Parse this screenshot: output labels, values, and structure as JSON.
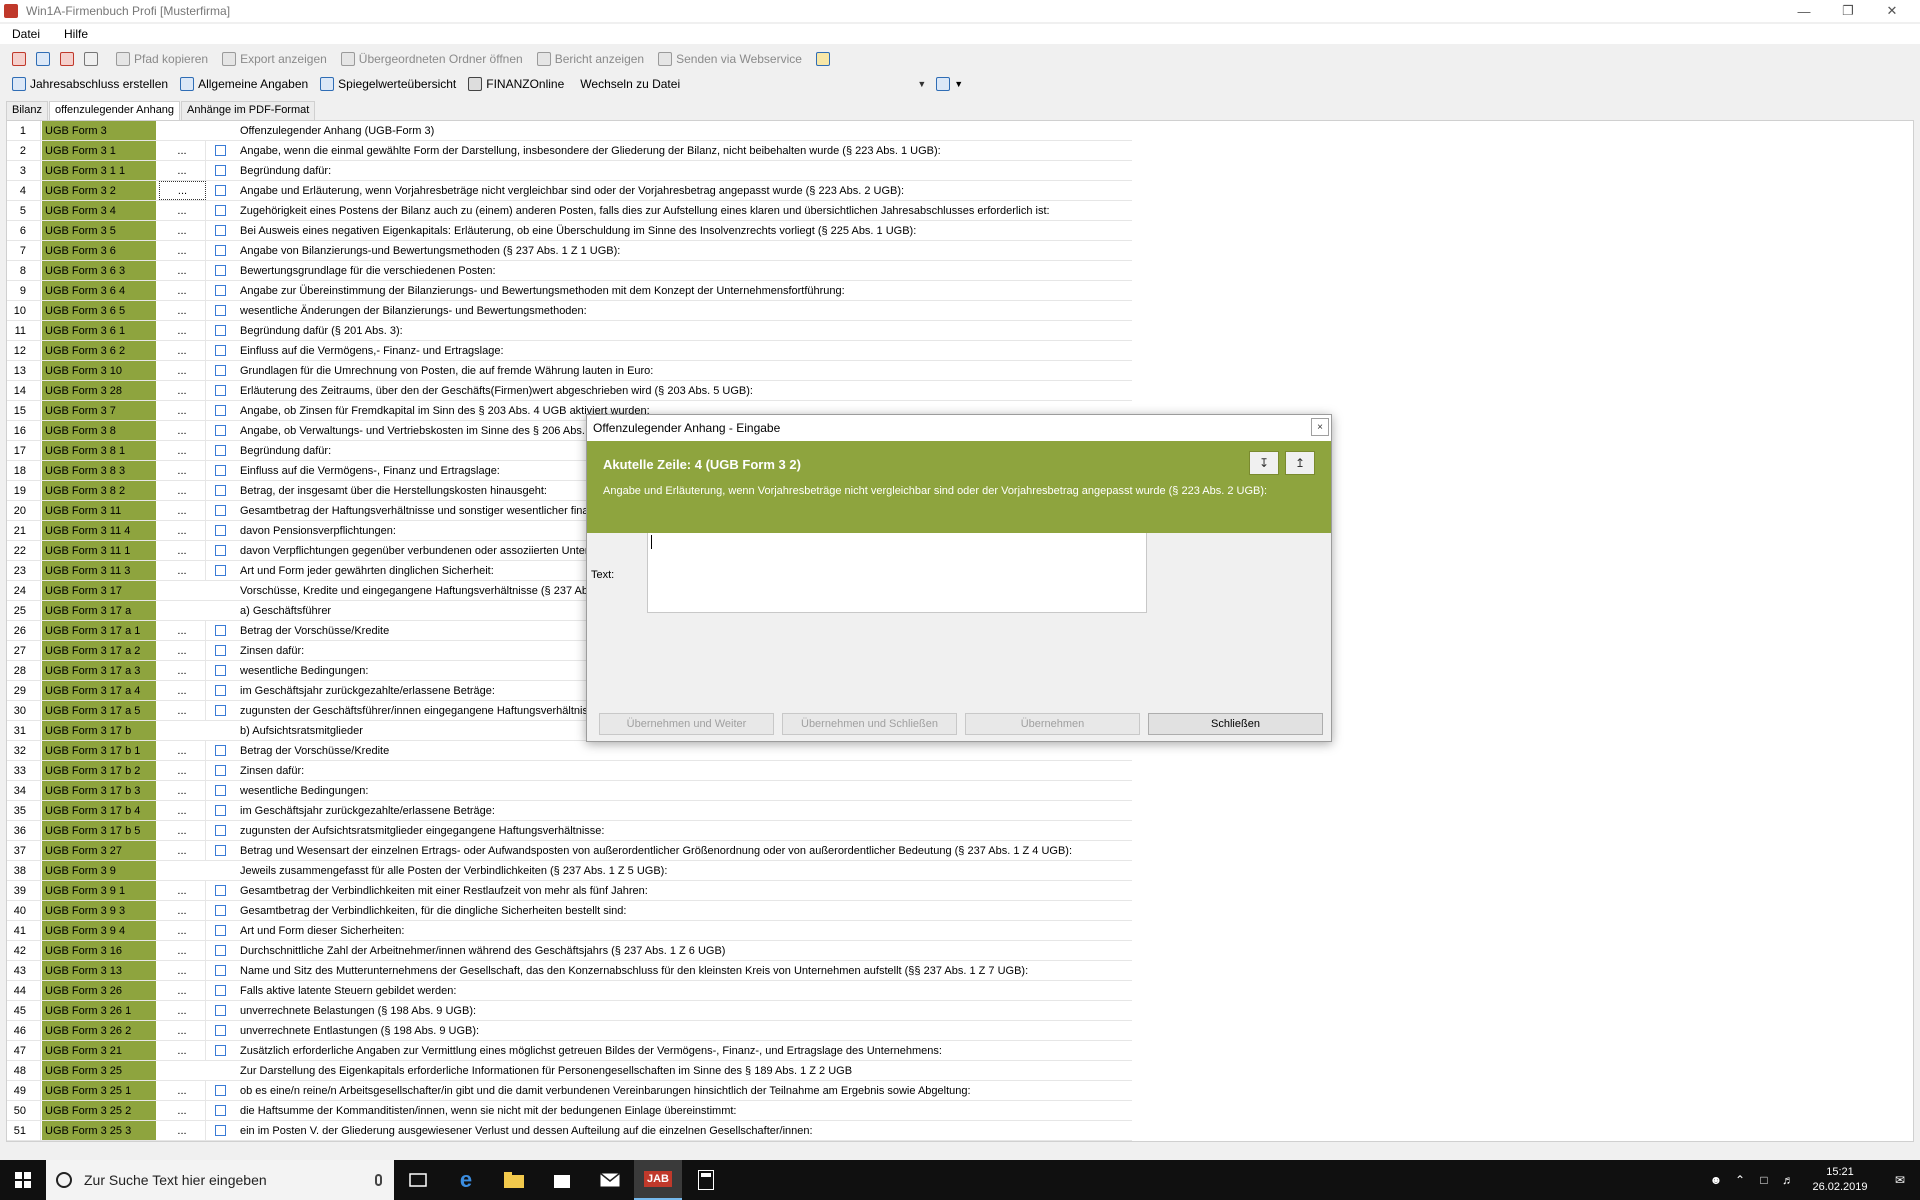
{
  "window": {
    "title": "Win1A-Firmenbuch Profi [Musterfirma]"
  },
  "menu": {
    "items": [
      "Datei",
      "Hilfe"
    ]
  },
  "toolbar1": {
    "buttons": [
      {
        "label": "Pfad kopieren",
        "icon": "copy-path-icon"
      },
      {
        "label": "Export anzeigen",
        "icon": "export-icon"
      },
      {
        "label": "Übergeordneten Ordner öffnen",
        "icon": "folder-icon"
      },
      {
        "label": "Bericht anzeigen",
        "icon": "report-icon"
      },
      {
        "label": "Senden via Webservice",
        "icon": "webservice-icon"
      }
    ]
  },
  "toolbar2": {
    "buttons": [
      {
        "label": "Jahresabschluss erstellen",
        "icon": "annual-report-icon"
      },
      {
        "label": "Allgemeine Angaben",
        "icon": "general-info-icon"
      },
      {
        "label": "Spiegelwerteübersicht",
        "icon": "mirror-values-icon"
      },
      {
        "label": "FINANZOnline",
        "icon": "finanzonline-icon"
      }
    ],
    "combo_label": "Wechseln zu Datei"
  },
  "tabs": [
    "Bilanz",
    "offenzulegender Anhang",
    "Anhänge im PDF-Format"
  ],
  "rows": [
    {
      "n": "1",
      "code": "UGB Form 3",
      "btn": false,
      "chk": false,
      "text": "Offenzulegender Anhang  (UGB-Form 3)"
    },
    {
      "n": "2",
      "code": "UGB Form 3 1",
      "btn": true,
      "chk": true,
      "text": "Angabe, wenn die einmal gewählte Form der Darstellung, insbesondere der Gliederung der Bilanz, nicht beibehalten wurde (§ 223 Abs. 1 UGB):"
    },
    {
      "n": "3",
      "code": "UGB Form 3 1 1",
      "btn": true,
      "chk": true,
      "text": "Begründung dafür:"
    },
    {
      "n": "4",
      "code": "UGB Form 3 2",
      "btn": true,
      "chk": true,
      "text": "Angabe und Erläuterung, wenn Vorjahresbeträge nicht vergleichbar sind oder der Vorjahresbetrag angepasst wurde (§ 223 Abs. 2 UGB):"
    },
    {
      "n": "5",
      "code": "UGB Form 3 4",
      "btn": true,
      "chk": true,
      "text": "Zugehörigkeit eines Postens der Bilanz auch zu (einem) anderen Posten, falls dies zur Aufstellung eines klaren und übersichtlichen Jahresabschlusses erforderlich ist:"
    },
    {
      "n": "6",
      "code": "UGB Form 3 5",
      "btn": true,
      "chk": true,
      "text": "Bei Ausweis eines negativen Eigenkapitals: Erläuterung, ob eine Überschuldung im Sinne des Insolvenzrechts vorliegt (§ 225 Abs. 1 UGB):"
    },
    {
      "n": "7",
      "code": "UGB Form 3 6",
      "btn": true,
      "chk": true,
      "text": "Angabe von Bilanzierungs-und Bewertungsmethoden (§ 237 Abs. 1 Z 1 UGB):"
    },
    {
      "n": "8",
      "code": "UGB Form 3 6 3",
      "btn": true,
      "chk": true,
      "text": "Bewertungsgrundlage für die verschiedenen Posten:"
    },
    {
      "n": "9",
      "code": "UGB Form 3 6 4",
      "btn": true,
      "chk": true,
      "text": "Angabe zur Übereinstimmung der Bilanzierungs- und Bewertungsmethoden mit dem Konzept der Unternehmensfortführung:"
    },
    {
      "n": "10",
      "code": "UGB Form 3 6 5",
      "btn": true,
      "chk": true,
      "text": "wesentliche Änderungen der Bilanzierungs- und Bewertungsmethoden:"
    },
    {
      "n": "11",
      "code": "UGB Form 3 6 1",
      "btn": true,
      "chk": true,
      "text": "Begründung dafür (§ 201 Abs. 3):"
    },
    {
      "n": "12",
      "code": "UGB Form 3 6 2",
      "btn": true,
      "chk": true,
      "text": "Einfluss auf die Vermögens,- Finanz- und Ertragslage:"
    },
    {
      "n": "13",
      "code": "UGB Form 3 10",
      "btn": true,
      "chk": true,
      "text": "Grundlagen für die Umrechnung von Posten, die auf fremde Währung lauten in Euro:"
    },
    {
      "n": "14",
      "code": "UGB Form 3 28",
      "btn": true,
      "chk": true,
      "text": "Erläuterung des Zeitraums, über den der Geschäfts(Firmen)wert abgeschrieben wird (§ 203 Abs. 5 UGB):"
    },
    {
      "n": "15",
      "code": "UGB Form 3 7",
      "btn": true,
      "chk": true,
      "text": "Angabe, ob Zinsen für Fremdkapital im Sinn des § 203 Abs. 4 UGB aktiviert wurden:"
    },
    {
      "n": "16",
      "code": "UGB Form 3 8",
      "btn": true,
      "chk": true,
      "text": "Angabe, ob Verwaltungs- und Vertriebskosten im Sinne des § 206 Abs. 3"
    },
    {
      "n": "17",
      "code": "UGB Form 3 8 1",
      "btn": true,
      "chk": true,
      "text": "Begründung dafür:"
    },
    {
      "n": "18",
      "code": "UGB Form 3 8 3",
      "btn": true,
      "chk": true,
      "text": "Einfluss auf die Vermögens-, Finanz und Ertragslage:"
    },
    {
      "n": "19",
      "code": "UGB Form 3 8 2",
      "btn": true,
      "chk": true,
      "text": "Betrag, der insgesamt über die Herstellungskosten hinausgeht:"
    },
    {
      "n": "20",
      "code": "UGB Form 3 11",
      "btn": true,
      "chk": true,
      "text": "Gesamtbetrag der Haftungsverhältnisse und sonstiger wesentlicher finan"
    },
    {
      "n": "21",
      "code": "UGB Form 3 11 4",
      "btn": true,
      "chk": true,
      "text": "davon Pensionsverpflichtungen:"
    },
    {
      "n": "22",
      "code": "UGB Form 3 11 1",
      "btn": true,
      "chk": true,
      "text": "davon Verpflichtungen gegenüber verbundenen oder assoziierten Unterne"
    },
    {
      "n": "23",
      "code": "UGB Form 3 11 3",
      "btn": true,
      "chk": true,
      "text": "Art und Form jeder gewährten dinglichen Sicherheit:"
    },
    {
      "n": "24",
      "code": "UGB Form 3 17",
      "btn": false,
      "chk": false,
      "text": "Vorschüsse, Kredite und eingegangene Haftungsverhältnisse (§ 237 Abs"
    },
    {
      "n": "25",
      "code": "UGB Form 3 17 a",
      "btn": false,
      "chk": false,
      "text": "a) Geschäftsführer"
    },
    {
      "n": "26",
      "code": "UGB Form 3 17 a 1",
      "btn": true,
      "chk": true,
      "text": "Betrag der Vorschüsse/Kredite"
    },
    {
      "n": "27",
      "code": "UGB Form 3 17 a 2",
      "btn": true,
      "chk": true,
      "text": "Zinsen dafür:"
    },
    {
      "n": "28",
      "code": "UGB Form 3 17 a 3",
      "btn": true,
      "chk": true,
      "text": "wesentliche Bedingungen:"
    },
    {
      "n": "29",
      "code": "UGB Form 3 17 a 4",
      "btn": true,
      "chk": true,
      "text": "im Geschäftsjahr zurückgezahlte/erlassene Beträge:"
    },
    {
      "n": "30",
      "code": "UGB Form 3 17 a 5",
      "btn": true,
      "chk": true,
      "text": "zugunsten der Geschäftsführer/innen eingegangene Haftungsverhältniss"
    },
    {
      "n": "31",
      "code": "UGB Form 3 17 b",
      "btn": false,
      "chk": false,
      "text": "b) Aufsichtsratsmitglieder"
    },
    {
      "n": "32",
      "code": "UGB Form 3 17 b 1",
      "btn": true,
      "chk": true,
      "text": "Betrag der Vorschüsse/Kredite"
    },
    {
      "n": "33",
      "code": "UGB Form 3 17 b 2",
      "btn": true,
      "chk": true,
      "text": "Zinsen dafür:"
    },
    {
      "n": "34",
      "code": "UGB Form 3 17 b 3",
      "btn": true,
      "chk": true,
      "text": "wesentliche Bedingungen:"
    },
    {
      "n": "35",
      "code": "UGB Form 3 17 b 4",
      "btn": true,
      "chk": true,
      "text": "im Geschäftsjahr zurückgezahlte/erlassene Beträge:"
    },
    {
      "n": "36",
      "code": "UGB Form 3 17 b 5",
      "btn": true,
      "chk": true,
      "text": "zugunsten der Aufsichtsratsmitglieder eingegangene Haftungsverhältnisse:"
    },
    {
      "n": "37",
      "code": "UGB Form 3 27",
      "btn": true,
      "chk": true,
      "text": "Betrag und Wesensart der einzelnen Ertrags- oder Aufwandsposten von außerordentlicher Größenordnung oder von außerordentlicher Bedeutung (§ 237 Abs. 1 Z 4 UGB):"
    },
    {
      "n": "38",
      "code": "UGB Form 3 9",
      "btn": false,
      "chk": false,
      "text": "Jeweils zusammengefasst für alle Posten der Verbindlichkeiten (§ 237 Abs. 1 Z 5 UGB):"
    },
    {
      "n": "39",
      "code": "UGB Form 3 9 1",
      "btn": true,
      "chk": true,
      "text": "Gesamtbetrag der Verbindlichkeiten mit einer Restlaufzeit von mehr als fünf Jahren:"
    },
    {
      "n": "40",
      "code": "UGB Form 3 9 3",
      "btn": true,
      "chk": true,
      "text": "Gesamtbetrag der Verbindlichkeiten, für die dingliche Sicherheiten bestellt sind:"
    },
    {
      "n": "41",
      "code": "UGB Form 3 9 4",
      "btn": true,
      "chk": true,
      "text": "Art und Form dieser Sicherheiten:"
    },
    {
      "n": "42",
      "code": "UGB Form 3 16",
      "btn": true,
      "chk": true,
      "text": "Durchschnittliche Zahl der Arbeitnehmer/innen während des Geschäftsjahrs (§ 237 Abs. 1 Z 6 UGB)"
    },
    {
      "n": "43",
      "code": "UGB Form 3 13",
      "btn": true,
      "chk": true,
      "text": "Name und Sitz des Mutterunternehmens der Gesellschaft, das den Konzernabschluss für den kleinsten Kreis von Unternehmen aufstellt (§§ 237 Abs. 1 Z 7 UGB):"
    },
    {
      "n": "44",
      "code": "UGB Form 3 26",
      "btn": true,
      "chk": true,
      "text": "Falls aktive latente Steuern gebildet werden:"
    },
    {
      "n": "45",
      "code": "UGB Form 3 26 1",
      "btn": true,
      "chk": true,
      "text": "unverrechnete Belastungen (§ 198 Abs. 9 UGB):"
    },
    {
      "n": "46",
      "code": "UGB Form 3 26 2",
      "btn": true,
      "chk": true,
      "text": "unverrechnete Entlastungen (§ 198 Abs. 9 UGB):"
    },
    {
      "n": "47",
      "code": "UGB Form 3 21",
      "btn": true,
      "chk": true,
      "text": "Zusätzlich erforderliche Angaben zur Vermittlung eines möglichst getreuen Bildes der Vermögens-, Finanz-, und Ertragslage des Unternehmens:"
    },
    {
      "n": "48",
      "code": "UGB Form 3 25",
      "btn": false,
      "chk": false,
      "text": "Zur Darstellung des Eigenkapitals erforderliche Informationen für Personengesellschaften im Sinne des § 189 Abs. 1 Z 2 UGB"
    },
    {
      "n": "49",
      "code": "UGB Form 3 25 1",
      "btn": true,
      "chk": true,
      "text": "ob es eine/n reine/n Arbeitsgesellschafter/in gibt und die damit verbundenen Vereinbarungen hinsichtlich der Teilnahme am Ergebnis sowie Abgeltung:"
    },
    {
      "n": "50",
      "code": "UGB Form 3 25 2",
      "btn": true,
      "chk": true,
      "text": "die Haftsumme der Kommanditisten/innen, wenn sie nicht mit der bedungenen Einlage übereinstimmt:"
    },
    {
      "n": "51",
      "code": "UGB Form 3 25 3",
      "btn": true,
      "chk": true,
      "text": "ein im Posten V. der Gliederung ausgewiesener Verlust und dessen Aufteilung auf die einzelnen Gesellschafter/innen:"
    }
  ],
  "row_button_label": "...",
  "dialog": {
    "title": "Offenzulegender Anhang - Eingabe",
    "heading": "Akutelle Zeile: 4 (UGB Form 3 2)",
    "description": "Angabe und Erläuterung, wenn Vorjahresbeträge nicht vergleichbar sind oder der Vorjahresbetrag angepasst wurde (§ 223 Abs. 2 UGB):",
    "text_label": "Text:",
    "text_value": "",
    "close_glyph": "×",
    "buttons": {
      "apply_next": "Übernehmen und Weiter",
      "apply_close": "Übernehmen und Schließen",
      "apply": "Übernehmen",
      "close": "Schließen"
    }
  },
  "taskbar": {
    "search_placeholder": "Zur Suche Text hier eingeben",
    "time": "15:21",
    "date": "26.02.2019"
  },
  "colors": {
    "accent_green": "#8ea43e"
  }
}
